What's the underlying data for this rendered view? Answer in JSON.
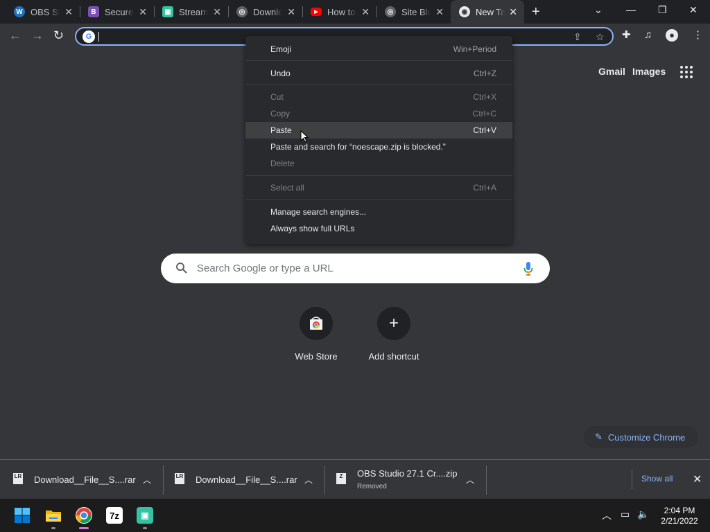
{
  "tabs": [
    {
      "title": "OBS Studio",
      "favicon": "wordpress-icon",
      "color": "#1e73be"
    },
    {
      "title": "Secure L",
      "favicon": "bootstrap-icon",
      "color": "#7952b3"
    },
    {
      "title": "Streamlabs",
      "favicon": "streamlabs-icon",
      "color": "#31c3a2"
    },
    {
      "title": "Download",
      "favicon": "globe-icon",
      "color": "#5f6368"
    },
    {
      "title": "How to",
      "favicon": "youtube-icon",
      "color": "#ff0000"
    },
    {
      "title": "Site Block",
      "favicon": "globe-icon",
      "color": "#5f6368"
    },
    {
      "title": "New Tab",
      "favicon": "chrome-icon",
      "color": "#35363a"
    }
  ],
  "omnibox": {
    "value": ""
  },
  "header_links": {
    "gmail": "Gmail",
    "images": "Images"
  },
  "context_menu": {
    "items": [
      {
        "label": "Emoji",
        "shortcut": "Win+Period",
        "enabled": true
      },
      {
        "label": "Undo",
        "shortcut": "Ctrl+Z",
        "enabled": true
      },
      {
        "label": "Cut",
        "shortcut": "Ctrl+X",
        "enabled": false
      },
      {
        "label": "Copy",
        "shortcut": "Ctrl+C",
        "enabled": false
      },
      {
        "label": "Paste",
        "shortcut": "Ctrl+V",
        "enabled": true,
        "hovered": true
      },
      {
        "label": "Paste and search for “noescape.zip is blocked.”",
        "shortcut": "",
        "enabled": true
      },
      {
        "label": "Delete",
        "shortcut": "",
        "enabled": false
      },
      {
        "label": "Select all",
        "shortcut": "Ctrl+A",
        "enabled": false
      },
      {
        "label": "Manage search engines...",
        "shortcut": "",
        "enabled": true
      },
      {
        "label": "Always show full URLs",
        "shortcut": "",
        "enabled": true
      }
    ]
  },
  "search": {
    "placeholder": "Search Google or type a URL"
  },
  "shortcuts": [
    {
      "label": "Web Store",
      "icon": "web-store-icon"
    },
    {
      "label": "Add shortcut",
      "icon": "plus-icon"
    }
  ],
  "customize": {
    "label": "Customize Chrome"
  },
  "downloads": {
    "items": [
      {
        "name": "Download__File__S....rar",
        "status": "",
        "icon": "rar-file-icon"
      },
      {
        "name": "Download__File__S....rar",
        "status": "",
        "icon": "rar-file-icon"
      },
      {
        "name": "OBS Studio 27.1 Cr....zip",
        "status": "Removed",
        "icon": "zip-file-icon"
      }
    ],
    "show_all": "Show all"
  },
  "taskbar": {
    "apps": [
      {
        "name": "windows-start-icon"
      },
      {
        "name": "file-explorer-icon"
      },
      {
        "name": "chrome-icon"
      },
      {
        "name": "7zip-icon",
        "label": "7z"
      },
      {
        "name": "streamlabs-icon"
      }
    ],
    "time": "2:04 PM",
    "date": "2/21/2022"
  }
}
